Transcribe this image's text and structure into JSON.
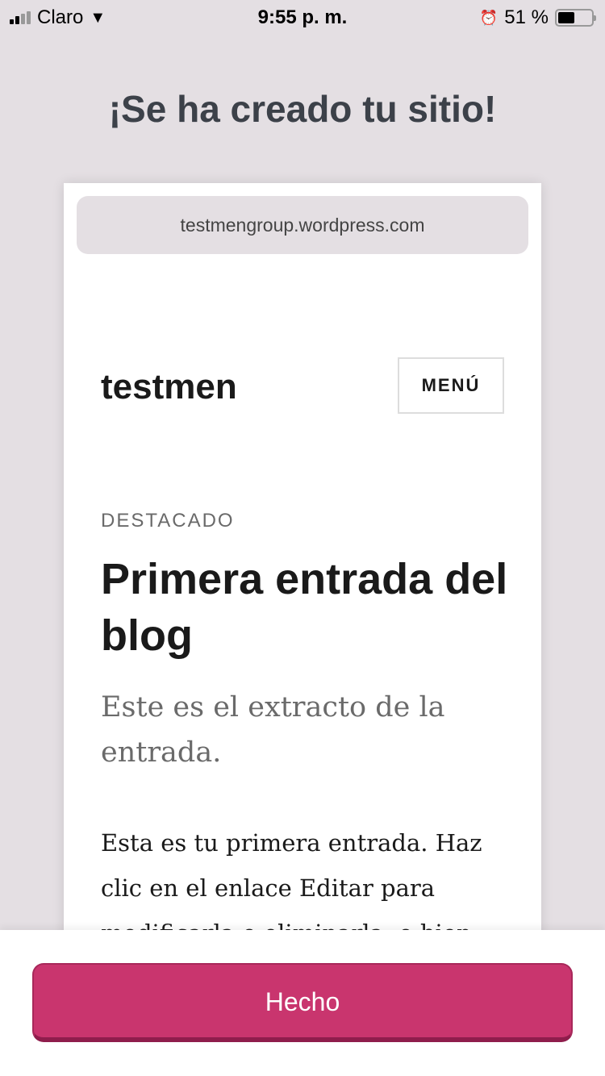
{
  "status_bar": {
    "carrier": "Claro",
    "time": "9:55 p. m.",
    "battery": "51 %",
    "battery_level": 0.51
  },
  "heading": "¡Se ha creado tu sitio!",
  "preview": {
    "url": "testmengroup.wordpress.com",
    "site_title": "testmen",
    "menu_label": "MENÚ",
    "featured_label": "DESTACADO",
    "post_title": "Primera entrada del blog",
    "excerpt": "Este es el extracto de la entrada.",
    "body": "Esta es tu primera entrada. Haz clic en el enlace Editar para modificarla o eliminarla, o bien"
  },
  "done_button": "Hecho",
  "colors": {
    "accent": "#c9356e",
    "background": "#e4dfe3"
  }
}
